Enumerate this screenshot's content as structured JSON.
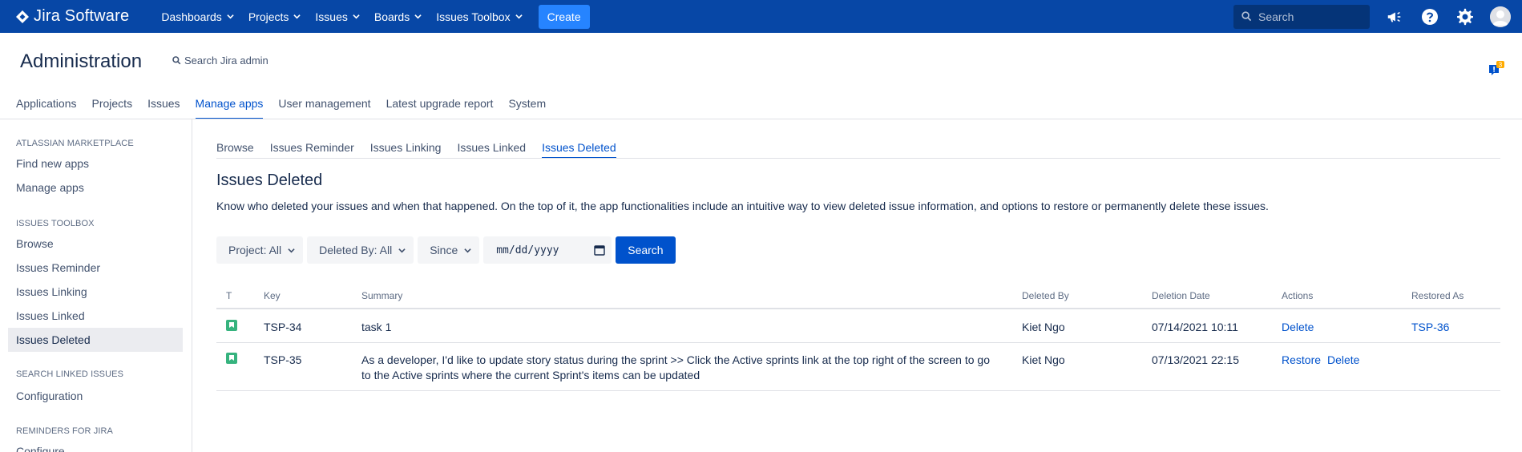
{
  "topnav": {
    "product": "Jira Software",
    "items": [
      {
        "label": "Dashboards"
      },
      {
        "label": "Projects"
      },
      {
        "label": "Issues"
      },
      {
        "label": "Boards"
      },
      {
        "label": "Issues Toolbox"
      }
    ],
    "create_label": "Create",
    "search_placeholder": "Search"
  },
  "admin": {
    "title": "Administration",
    "search_label": "Search Jira admin",
    "notification_count": "3",
    "tabs": [
      {
        "label": "Applications"
      },
      {
        "label": "Projects"
      },
      {
        "label": "Issues"
      },
      {
        "label": "Manage apps",
        "active": true
      },
      {
        "label": "User management"
      },
      {
        "label": "Latest upgrade report"
      },
      {
        "label": "System"
      }
    ]
  },
  "sidebar": {
    "sections": [
      {
        "title": "ATLASSIAN MARKETPLACE",
        "items": [
          {
            "label": "Find new apps"
          },
          {
            "label": "Manage apps"
          }
        ]
      },
      {
        "title": "ISSUES TOOLBOX",
        "items": [
          {
            "label": "Browse"
          },
          {
            "label": "Issues Reminder"
          },
          {
            "label": "Issues Linking"
          },
          {
            "label": "Issues Linked"
          },
          {
            "label": "Issues Deleted",
            "active": true
          }
        ]
      },
      {
        "title": "SEARCH LINKED ISSUES",
        "items": [
          {
            "label": "Configuration"
          }
        ]
      },
      {
        "title": "REMINDERS FOR JIRA",
        "items": [
          {
            "label": "Configure"
          }
        ]
      }
    ]
  },
  "main": {
    "tabs": [
      {
        "label": "Browse"
      },
      {
        "label": "Issues Reminder"
      },
      {
        "label": "Issues Linking"
      },
      {
        "label": "Issues Linked"
      },
      {
        "label": "Issues Deleted",
        "active": true
      }
    ],
    "title": "Issues Deleted",
    "description": "Know who deleted your issues and when that happened. On the top of it, the app functionalities include an intuitive way to view deleted issue information, and options to restore or permanently delete these issues.",
    "filters": {
      "project": "Project: All",
      "deleted_by": "Deleted By: All",
      "since": "Since",
      "date_placeholder": "mm/dd/yyyy",
      "search_label": "Search"
    },
    "table": {
      "headers": {
        "type": "T",
        "key": "Key",
        "summary": "Summary",
        "deleted_by": "Deleted By",
        "deletion_date": "Deletion Date",
        "actions": "Actions",
        "restored_as": "Restored As"
      },
      "rows": [
        {
          "key": "TSP-34",
          "summary_line1": "task 1",
          "summary_line2": "",
          "deleted_by": "Kiet Ngo",
          "deletion_date": "07/14/2021 10:11",
          "action1": "Delete",
          "action2": "",
          "restored_as": "TSP-36"
        },
        {
          "key": "TSP-35",
          "summary_line1": "As a developer, I'd like to update story status during the sprint >> Click the Active sprints link at the top right of the screen to go",
          "summary_line2": "to the Active sprints where the current Sprint's items can be updated",
          "deleted_by": "Kiet Ngo",
          "deletion_date": "07/13/2021 22:15",
          "action1": "Restore",
          "action2": "Delete",
          "restored_as": ""
        }
      ]
    }
  },
  "colors": {
    "nav_bg": "#0747a6",
    "primary": "#0052cc",
    "create_btn": "#2684ff",
    "story_icon": "#36b37e"
  },
  "icons": [
    "jira-logo-icon",
    "chevron-down-icon",
    "search-icon",
    "megaphone-icon",
    "help-icon",
    "gear-icon",
    "avatar",
    "notification-icon",
    "calendar-icon",
    "story-icon"
  ]
}
